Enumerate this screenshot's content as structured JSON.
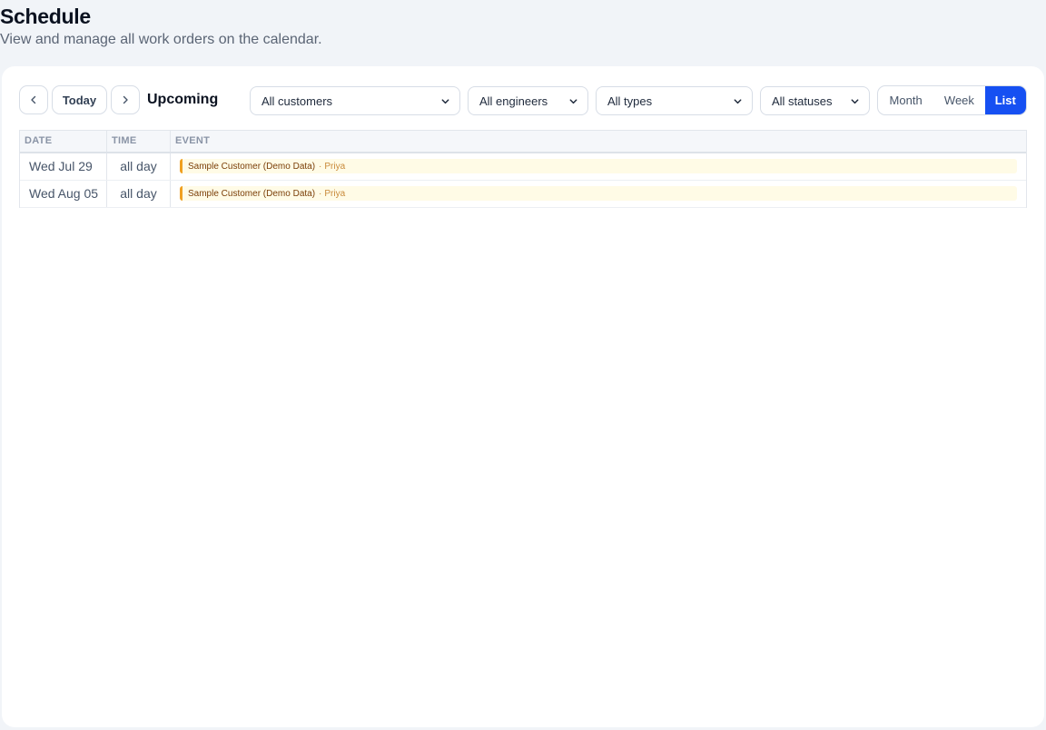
{
  "header": {
    "title": "Schedule",
    "subtitle": "View and manage all work orders on the calendar."
  },
  "toolbar": {
    "prev_icon": "chevron-left-icon",
    "today_label": "Today",
    "next_icon": "chevron-right-icon",
    "range_title": "Upcoming",
    "filters": {
      "customers": "All customers",
      "engineers": "All engineers",
      "types": "All types",
      "statuses": "All statuses"
    },
    "views": {
      "month": "Month",
      "week": "Week",
      "list": "List",
      "active": "List"
    }
  },
  "colors": {
    "accent": "#1650f2",
    "event_bar": "#f0a020",
    "event_bg": "#fffbe6"
  },
  "table": {
    "columns": {
      "date": "DATE",
      "time": "TIME",
      "event": "EVENT"
    },
    "rows": [
      {
        "date": "Wed Jul 29",
        "time": "all day",
        "title": "Sample Customer (Demo Data)",
        "separator": "·",
        "person": "Priya"
      },
      {
        "date": "Wed Aug 05",
        "time": "all day",
        "title": "Sample Customer (Demo Data)",
        "separator": "·",
        "person": "Priya"
      }
    ]
  }
}
